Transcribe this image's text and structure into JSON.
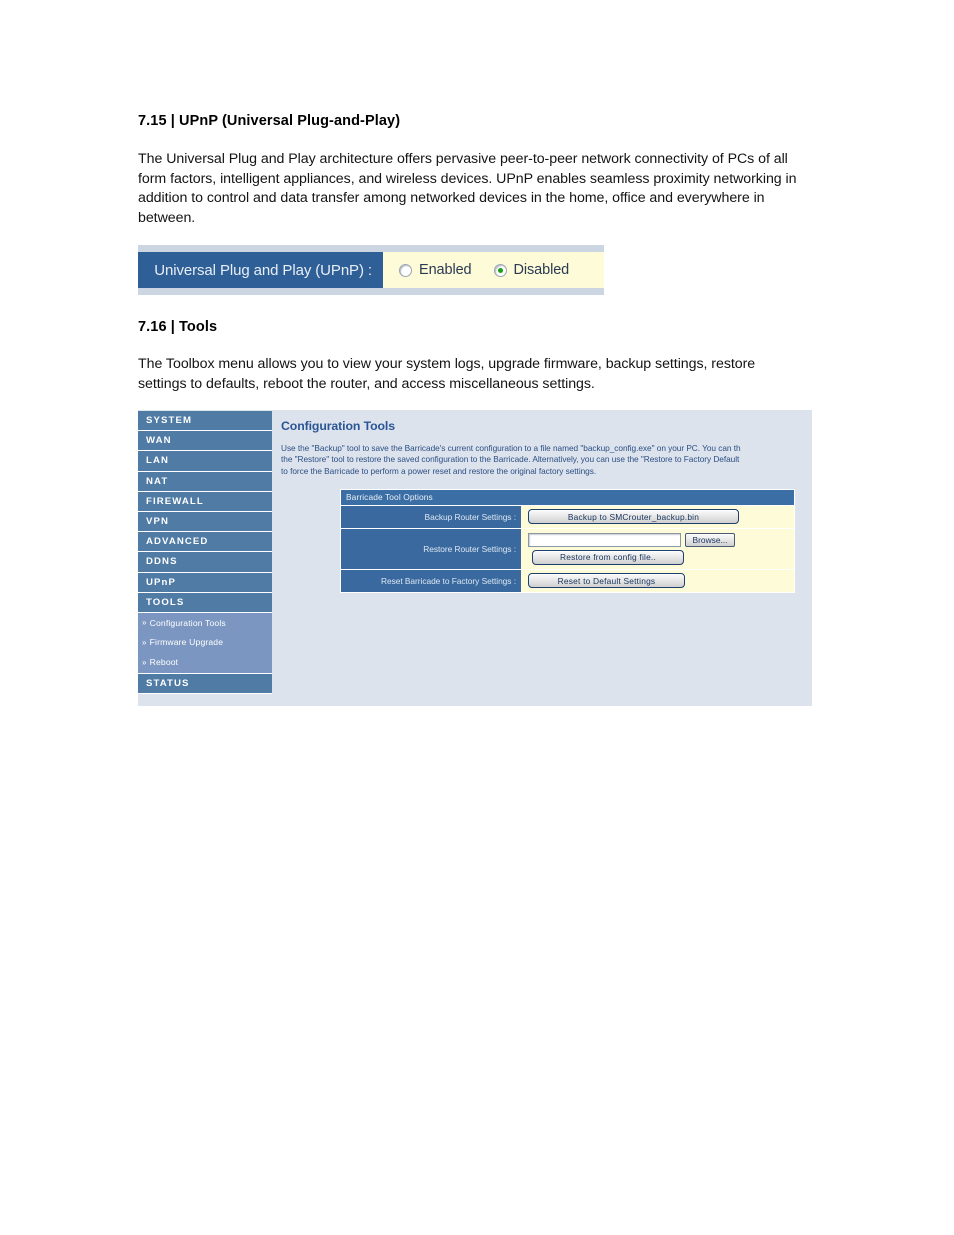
{
  "doc": {
    "section_upnp": {
      "heading": "7.15 | UPnP (Universal Plug-and-Play)",
      "paragraph": "The Universal Plug and Play architecture offers pervasive peer-to-peer network connectivity of PCs of all form factors, intelligent appliances, and wireless devices. UPnP enables seamless proximity networking in addition to control and data transfer among networked devices in the home, office and everywhere in between."
    },
    "section_tools": {
      "heading": "7.16 | Tools",
      "paragraph": "The Toolbox menu allows you to view your system logs, upgrade firmware, backup settings, restore settings to defaults, reboot the router, and access miscellaneous settings."
    }
  },
  "upnp_widget": {
    "label": "Universal Plug and Play (UPnP) :",
    "options": [
      {
        "label": "Enabled",
        "selected": false
      },
      {
        "label": "Disabled",
        "selected": true
      }
    ],
    "selected_value": "Disabled",
    "colors": {
      "label_bg": "#2e5f96",
      "value_bg": "#fdfbd8",
      "frame_bg": "#ccd5e2",
      "radio_dot": "#18a018"
    }
  },
  "router_ui": {
    "sidebar": {
      "items": [
        {
          "label": "SYSTEM"
        },
        {
          "label": "WAN"
        },
        {
          "label": "LAN"
        },
        {
          "label": "NAT"
        },
        {
          "label": "FIREWALL"
        },
        {
          "label": "VPN"
        },
        {
          "label": "ADVANCED"
        },
        {
          "label": "DDNS"
        },
        {
          "label": "UPnP"
        },
        {
          "label": "TOOLS"
        }
      ],
      "sub_items": [
        {
          "arrow": "»",
          "label": "Configuration Tools"
        },
        {
          "arrow": "»",
          "label": "Firmware Upgrade"
        },
        {
          "arrow": "»",
          "label": "Reboot"
        }
      ],
      "last_item": {
        "label": "STATUS"
      },
      "colors": {
        "item_bg": "#4f7ba5",
        "sub_bg": "#7b96c0",
        "panel_bg": "#dde3ec"
      }
    },
    "content": {
      "title": "Configuration Tools",
      "description_lines": [
        "Use the \"Backup\" tool to save the Barricade's current configuration to a file named \"backup_config.exe\" on your PC. You can th",
        "the \"Restore\" tool to restore the saved configuration to the Barricade. Alternatively, you can use the \"Restore to Factory Default",
        "to force the Barricade to perform a power reset and restore the original factory settings."
      ],
      "table": {
        "header": "Barricade Tool Options",
        "rows": [
          {
            "label": "Backup Router Settings :",
            "button": "Backup to SMCrouter_backup.bin"
          },
          {
            "label": "Restore Router Settings :",
            "file_value": "",
            "file_placeholder": "",
            "browse_button": "Browse...",
            "button": "Restore from config file.."
          },
          {
            "label": "Reset Barricade to Factory Settings :",
            "button": "Reset to Default Settings"
          }
        ]
      }
    }
  }
}
